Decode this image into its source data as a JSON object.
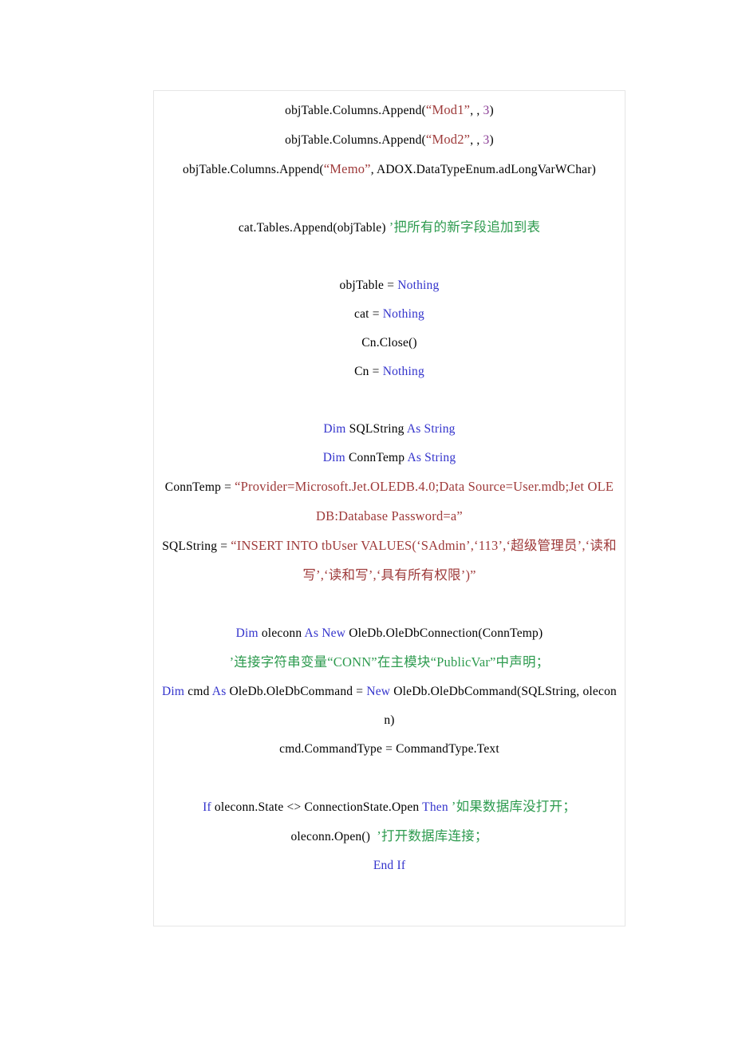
{
  "document": {
    "title": "VB.NET 数据库代码清单",
    "frame": {
      "border_color": "#e6e6e6",
      "background": "#ffffff"
    },
    "syntax_colors": {
      "plain": "#000000",
      "keyword": "#3333cc",
      "string": "#9e3a3a",
      "number": "#8a3c96",
      "comment": "#2e9b4f"
    }
  },
  "code": {
    "lines": [
      {
        "id": "line-append-mod1",
        "segments": [
          {
            "role": "plain",
            "text": "objTable.Columns.Append("
          },
          {
            "role": "string",
            "text": "“Mod1”"
          },
          {
            "role": "plain",
            "text": ", , "
          },
          {
            "role": "number",
            "text": "3"
          },
          {
            "role": "plain",
            "text": ")"
          }
        ]
      },
      {
        "id": "line-append-mod2",
        "segments": [
          {
            "role": "plain",
            "text": "objTable.Columns.Append("
          },
          {
            "role": "string",
            "text": "“Mod2”"
          },
          {
            "role": "plain",
            "text": ", , "
          },
          {
            "role": "number",
            "text": "3"
          },
          {
            "role": "plain",
            "text": ")"
          }
        ]
      },
      {
        "id": "line-append-memo",
        "wrap": true,
        "segments": [
          {
            "role": "plain",
            "text": "objTable.Columns.Append("
          },
          {
            "role": "string",
            "text": "“Memo”"
          },
          {
            "role": "plain",
            "text": ", ADOX.DataTypeEnum.adLongVarWChar)"
          }
        ]
      },
      {
        "id": "gap-1",
        "gap": true
      },
      {
        "id": "line-tables-append",
        "segments": [
          {
            "role": "plain",
            "text": "cat.Tables.Append(objTable) "
          },
          {
            "role": "comment",
            "text": "’把所有的新字段追加到表"
          }
        ]
      },
      {
        "id": "gap-2",
        "gap": true
      },
      {
        "id": "line-objtable-nothing",
        "segments": [
          {
            "role": "plain",
            "text": "objTable = "
          },
          {
            "role": "keyword",
            "text": "Nothing"
          }
        ]
      },
      {
        "id": "line-cat-nothing",
        "segments": [
          {
            "role": "plain",
            "text": "cat = "
          },
          {
            "role": "keyword",
            "text": "Nothing"
          }
        ]
      },
      {
        "id": "line-cn-close",
        "segments": [
          {
            "role": "plain",
            "text": "Cn.Close()"
          }
        ]
      },
      {
        "id": "line-cn-nothing",
        "segments": [
          {
            "role": "plain",
            "text": "Cn = "
          },
          {
            "role": "keyword",
            "text": "Nothing"
          }
        ]
      },
      {
        "id": "gap-3",
        "gap": true
      },
      {
        "id": "line-dim-sqlstring",
        "segments": [
          {
            "role": "keyword",
            "text": "Dim"
          },
          {
            "role": "plain",
            "text": " SQLString "
          },
          {
            "role": "keyword",
            "text": "As String"
          }
        ]
      },
      {
        "id": "line-dim-conntemp",
        "segments": [
          {
            "role": "keyword",
            "text": "Dim"
          },
          {
            "role": "plain",
            "text": " ConnTemp "
          },
          {
            "role": "keyword",
            "text": "As String"
          }
        ]
      },
      {
        "id": "line-conntemp-assign",
        "wrap": true,
        "segments": [
          {
            "role": "plain",
            "text": "ConnTemp = "
          },
          {
            "role": "string",
            "text": "“Provider=Microsoft.Jet.OLEDB.4.0;Data Source=User.mdb;Jet OLEDB:Database Password=a”"
          }
        ]
      },
      {
        "id": "line-sqlstring-assign",
        "wrap": true,
        "segments": [
          {
            "role": "plain",
            "text": "SQLString = "
          },
          {
            "role": "string",
            "text": "“INSERT INTO tbUser VALUES(‘SAdmin’,‘113’,‘超级管理员’,‘读和写’,‘读和写’,‘具有所有权限’)”"
          }
        ]
      },
      {
        "id": "gap-4",
        "gap": true
      },
      {
        "id": "line-dim-oleconn",
        "segments": [
          {
            "role": "keyword",
            "text": "Dim"
          },
          {
            "role": "plain",
            "text": " oleconn "
          },
          {
            "role": "keyword",
            "text": "As New"
          },
          {
            "role": "plain",
            "text": " OleDb.OleDbConnection(ConnTemp)"
          }
        ]
      },
      {
        "id": "line-comment-conn",
        "segments": [
          {
            "role": "comment",
            "text": "’连接字符串变量“CONN”在主模块“PublicVar”中声明；"
          }
        ]
      },
      {
        "id": "line-dim-cmd",
        "wrap": true,
        "segments": [
          {
            "role": "keyword",
            "text": "Dim"
          },
          {
            "role": "plain",
            "text": " cmd "
          },
          {
            "role": "keyword",
            "text": "As"
          },
          {
            "role": "plain",
            "text": " OleDb.OleDbCommand = "
          },
          {
            "role": "keyword",
            "text": "New"
          },
          {
            "role": "plain",
            "text": " OleDb.OleDbCommand(SQLString, oleconn)"
          }
        ]
      },
      {
        "id": "line-cmd-commandtype",
        "segments": [
          {
            "role": "plain",
            "text": "cmd.CommandType = CommandType.Text"
          }
        ]
      },
      {
        "id": "gap-5",
        "gap": true
      },
      {
        "id": "line-if-state",
        "wrap": true,
        "segments": [
          {
            "role": "keyword",
            "text": "If"
          },
          {
            "role": "plain",
            "text": " oleconn.State <> ConnectionState.Open "
          },
          {
            "role": "keyword",
            "text": "Then"
          },
          {
            "role": "plain",
            "text": " "
          },
          {
            "role": "comment",
            "text": "’如果数据库没打开；"
          }
        ]
      },
      {
        "id": "line-oleconn-open",
        "segments": [
          {
            "role": "plain",
            "text": "oleconn.Open()  "
          },
          {
            "role": "comment",
            "text": "’打开数据库连接；"
          }
        ]
      },
      {
        "id": "line-end-if",
        "segments": [
          {
            "role": "keyword",
            "text": "End If"
          }
        ]
      }
    ]
  }
}
